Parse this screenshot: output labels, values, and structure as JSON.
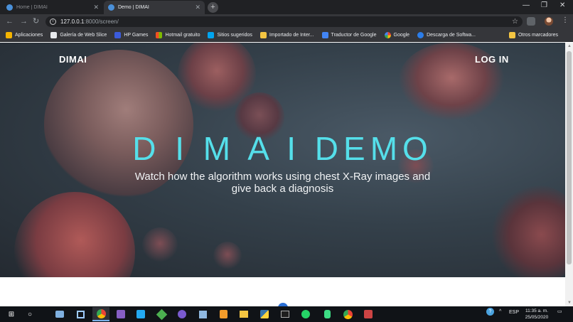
{
  "browser": {
    "tabs": [
      {
        "title": "Home | DIMAI",
        "active": false
      },
      {
        "title": "Demo | DIMAI",
        "active": true
      }
    ],
    "new_tab_icon": "plus",
    "window_controls": [
      "—",
      "❐",
      "✕"
    ],
    "address": {
      "host": "127.0.0.1",
      "path": ":8000/screen/"
    },
    "bookmarks": [
      {
        "label": "Aplicaciones",
        "icon": "apps-grid",
        "color": "#f4b400"
      },
      {
        "label": "Galería de Web Slice",
        "icon": "slice",
        "color": "#e8eaed"
      },
      {
        "label": "HP Games",
        "icon": "hp-games",
        "color": "#3b5bdb"
      },
      {
        "label": "Hotmail gratuito",
        "icon": "windows",
        "color": "#f25022"
      },
      {
        "label": "Sitios sugeridos",
        "icon": "bing",
        "color": "#00a4ef"
      },
      {
        "label": "Importado de Inter...",
        "icon": "folder",
        "color": "#f4c542"
      },
      {
        "label": "Traductor de Google",
        "icon": "translate",
        "color": "#4285f4"
      },
      {
        "label": "Google",
        "icon": "google",
        "color": "#ffffff"
      },
      {
        "label": "Descarga de Softwa...",
        "icon": "globe",
        "color": "#2b7de9"
      }
    ],
    "other_bookmarks": "Otros marcadores"
  },
  "page": {
    "brand": "DIMAI",
    "login": "LOG IN",
    "hero_title": "D I M A I DEMO",
    "hero_subtitle": "Watch how the algorithm works using chest X-Ray images and give back a diagnosis",
    "accent_color": "#55dfea"
  },
  "taskbar": {
    "apps": [
      "start",
      "search",
      "task-view",
      "store",
      "chrome",
      "visual-studio",
      "vscode",
      "git",
      "obs",
      "virtualbox",
      "sublime",
      "explorer",
      "python",
      "terminal",
      "whatsapp",
      "android",
      "chrome-2",
      "snipping"
    ],
    "language": "ESP",
    "time": "11:35 a. m.",
    "date": "25/05/2020"
  }
}
